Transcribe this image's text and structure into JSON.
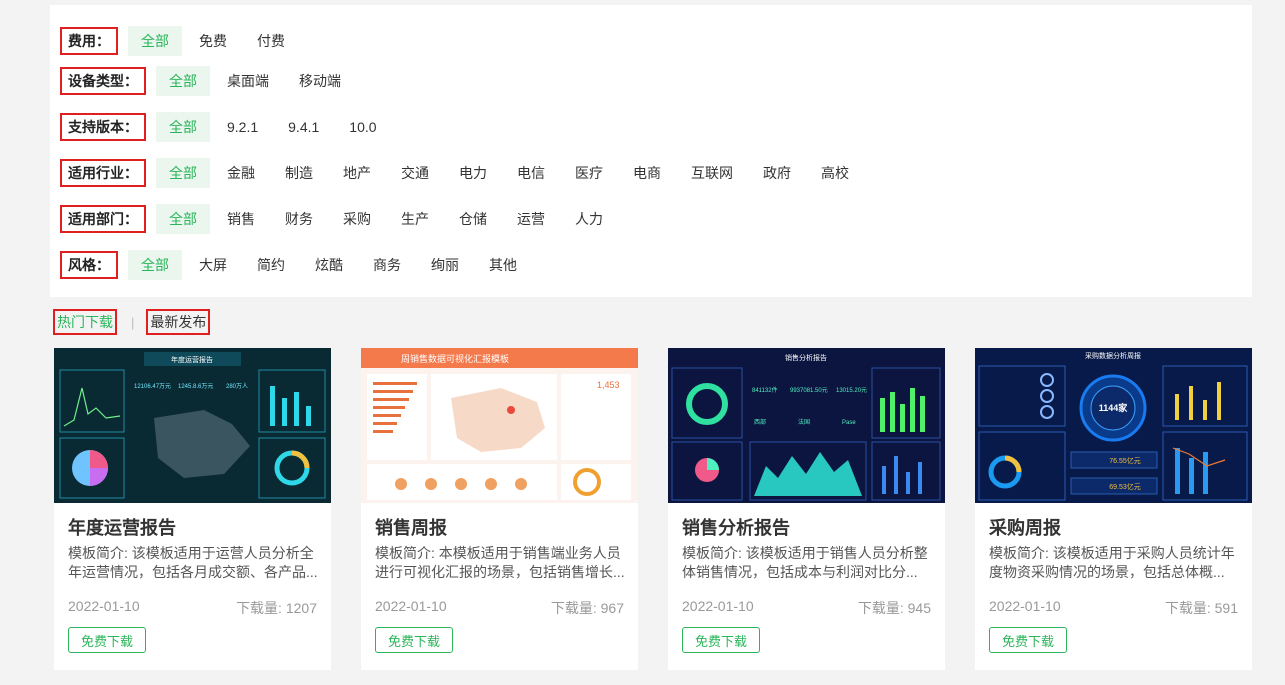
{
  "filters": [
    {
      "label": "费用：",
      "options": [
        "全部",
        "免费",
        "付费"
      ],
      "selected": 0
    },
    {
      "label": "设备类型：",
      "options": [
        "全部",
        "桌面端",
        "移动端"
      ],
      "selected": 0
    },
    {
      "label": "支持版本：",
      "options": [
        "全部",
        "9.2.1",
        "9.4.1",
        "10.0"
      ],
      "selected": 0
    },
    {
      "label": "适用行业：",
      "options": [
        "全部",
        "金融",
        "制造",
        "地产",
        "交通",
        "电力",
        "电信",
        "医疗",
        "电商",
        "互联网",
        "政府",
        "高校"
      ],
      "selected": 0
    },
    {
      "label": "适用部门：",
      "options": [
        "全部",
        "销售",
        "财务",
        "采购",
        "生产",
        "仓储",
        "运营",
        "人力"
      ],
      "selected": 0
    },
    {
      "label": "风格：",
      "options": [
        "全部",
        "大屏",
        "简约",
        "炫酷",
        "商务",
        "绚丽",
        "其他"
      ],
      "selected": 0
    }
  ],
  "sort": {
    "hot": "热门下载",
    "sep": "|",
    "latest": "最新发布"
  },
  "cards": [
    {
      "title": "年度运营报告",
      "desc": "模板简介: 该模板适用于运营人员分析全年运营情况，包括各月成交额、各产品...",
      "date": "2022-01-10",
      "downloads": "下载量: 1207",
      "button": "免费下载",
      "thumb": {
        "heading": "年度运营报告",
        "sub1": "12106.47万元",
        "sub2": "1245.8.6万元",
        "sub3": "280万人"
      }
    },
    {
      "title": "销售周报",
      "desc": "模板简介: 本模板适用于销售端业务人员进行可视化汇报的场景，包括销售增长...",
      "date": "2022-01-10",
      "downloads": "下载量: 967",
      "button": "免费下载",
      "thumb": {
        "heading": "周销售数据可视化汇报模板",
        "sub1": "1,453"
      }
    },
    {
      "title": "销售分析报告",
      "desc": "模板简介: 该模板适用于销售人员分析整体销售情况，包括成本与利润对比分...",
      "date": "2022-01-10",
      "downloads": "下载量: 945",
      "button": "免费下载",
      "thumb": {
        "heading": "销售分析报告",
        "sub1": "841132件",
        "sub2": "9937081.50元",
        "sub3": "13015.20元",
        "sub4": "西部",
        "sub5": "法国",
        "sub6": "Pase"
      }
    },
    {
      "title": "采购周报",
      "desc": "模板简介: 该模板适用于采购人员统计年度物资采购情况的场景，包括总体概...",
      "date": "2022-01-10",
      "downloads": "下载量: 591",
      "button": "免费下载",
      "thumb": {
        "heading": "采购数据分析周报",
        "sub1": "1144家",
        "sub2": "76.55亿元",
        "sub3": "69.53亿元"
      }
    }
  ],
  "colors": {
    "accent": "#2bb55a",
    "highlight": "#e02020",
    "dark_thumb": "#0b1a3a",
    "light_thumb": "#f06a3c"
  }
}
